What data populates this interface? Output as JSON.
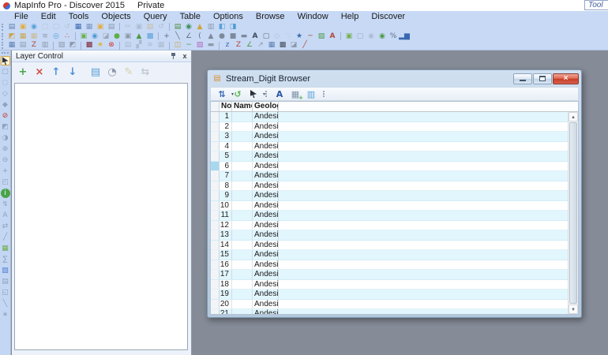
{
  "titlebar": {
    "title": "MapInfo Pro - Discover 2015",
    "private_label": "Private",
    "app_icon": "mapinfo-logo"
  },
  "tool_button": {
    "label": "Tool"
  },
  "menu": [
    "File",
    "Edit",
    "Tools",
    "Objects",
    "Query",
    "Table",
    "Options",
    "Browse",
    "Window",
    "Help",
    "Discover"
  ],
  "main_toolbar_rows": [
    [
      [
        {
          "n": "new-table",
          "g": "▤",
          "c": "#5f7fae"
        },
        {
          "n": "open",
          "g": "▣",
          "c": "#e2ae46"
        },
        {
          "n": "open-web-service",
          "g": "◉",
          "c": "#58a0d8"
        },
        {
          "n": "close-table",
          "g": "▢",
          "c": "#a6b2c2",
          "o": 0.55
        },
        {
          "n": "close-all",
          "g": "▢",
          "c": "#a6b2c2",
          "o": 0.55
        },
        {
          "n": "revert-table",
          "g": "↺",
          "c": "#a6b2c2",
          "o": 0.55
        },
        {
          "n": "save-table",
          "g": "▦",
          "c": "#3a68b0"
        },
        {
          "n": "save-copy-as",
          "g": "▦",
          "c": "#7a97c4"
        },
        {
          "n": "save-workspace",
          "g": "▣",
          "c": "#e2ae46"
        },
        {
          "n": "print",
          "g": "▤",
          "c": "#8d99aa"
        }
      ],
      [
        {
          "n": "cut",
          "g": "✂",
          "c": "#9aa6b6",
          "o": 0.55
        },
        {
          "n": "copy",
          "g": "▣",
          "c": "#9aa6b6",
          "o": 0.55
        },
        {
          "n": "paste",
          "g": "▤",
          "c": "#c9a45a",
          "o": 0.55
        },
        {
          "n": "undo",
          "g": "↺",
          "c": "#9aa6b6",
          "o": 0.55
        }
      ],
      [
        {
          "n": "new-browser",
          "g": "▤",
          "c": "#4d8e3f"
        },
        {
          "n": "new-mapper",
          "g": "◉",
          "c": "#3f8e5a"
        },
        {
          "n": "new-grapher",
          "g": "▲",
          "c": "#d2a23c"
        },
        {
          "n": "new-layout",
          "g": "▥",
          "c": "#8d99aa"
        },
        {
          "n": "new-redistricter",
          "g": "◧",
          "c": "#58a0d8"
        },
        {
          "n": "window-hot-views",
          "g": "◨",
          "c": "#4e9ad4"
        }
      ]
    ],
    [
      [
        {
          "n": "invert-selection",
          "g": "◩",
          "c": "#caa64e"
        },
        {
          "n": "select-all",
          "g": "▦",
          "c": "#caa64e"
        },
        {
          "n": "unselect-all",
          "g": "▦",
          "c": "#caa64e",
          "o": 0.6
        },
        {
          "n": "table-structure",
          "g": "≡",
          "c": "#8d99aa"
        },
        {
          "n": "geocode",
          "g": "◎",
          "c": "#58a0d8"
        },
        {
          "n": "create-points",
          "g": "∴",
          "c": "#c0564a"
        }
      ],
      [
        {
          "n": "run-mapbasic",
          "g": "▣",
          "c": "#6fae4e"
        },
        {
          "n": "world-map",
          "g": "◉",
          "c": "#4e9ad4"
        },
        {
          "n": "graph-window",
          "g": "◪",
          "c": "#9aa6b6"
        },
        {
          "n": "debug-tool",
          "g": "●",
          "c": "#5fae46"
        },
        {
          "n": "snapshot",
          "g": "▣",
          "c": "#8d99aa"
        },
        {
          "n": "tree-layers",
          "g": "▲",
          "c": "#4e9a46"
        },
        {
          "n": "packager",
          "g": "▩",
          "c": "#58a0d8"
        }
      ],
      [
        {
          "n": "symbol-tool",
          "g": "+",
          "c": "#5f6e80"
        },
        {
          "n": "line-tool",
          "g": "╲",
          "c": "#5f6e80"
        },
        {
          "n": "polyline-tool",
          "g": "∠",
          "c": "#5f6e80"
        },
        {
          "n": "arc-tool",
          "g": "(",
          "c": "#5f6e80"
        },
        {
          "n": "polygon-tool",
          "g": "▲",
          "c": "#7d8a9a"
        },
        {
          "n": "ellipse-tool",
          "g": "●",
          "c": "#7d8a9a"
        },
        {
          "n": "rectangle-tool",
          "g": "■",
          "c": "#7d8a9a"
        },
        {
          "n": "rounded-rectangle-tool",
          "g": "▬",
          "c": "#7d8a9a"
        },
        {
          "n": "text-tool",
          "g": "A",
          "c": "#3d4a5a"
        },
        {
          "n": "frame-tool",
          "g": "▢",
          "c": "#5f6e80"
        },
        {
          "n": "reshape-tool",
          "g": "◇",
          "c": "#9aa6b6",
          "o": 0.55
        },
        {
          "n": "add-node-tool",
          "g": "∵",
          "c": "#9aa6b6",
          "o": 0.55
        },
        {
          "n": "symbol-style",
          "g": "★",
          "c": "#3a68b0"
        },
        {
          "n": "line-style",
          "g": "─",
          "c": "#b04a3c"
        },
        {
          "n": "region-style",
          "g": "▨",
          "c": "#4e9a46"
        },
        {
          "n": "text-style",
          "g": "A",
          "c": "#b04a3c"
        }
      ],
      [
        {
          "n": "discover-folder",
          "g": "▣",
          "c": "#76b050"
        },
        {
          "n": "discover-window",
          "g": "▢",
          "c": "#9aa6b6"
        },
        {
          "n": "discover-link",
          "g": "◉",
          "c": "#9aa6b6",
          "o": 0.6
        },
        {
          "n": "discover-world",
          "g": "◉",
          "c": "#4e9a46"
        },
        {
          "n": "discover-scale",
          "g": "%",
          "c": "#5f6e80"
        },
        {
          "n": "discover-graph",
          "g": "▂▆",
          "c": "#3a68b0"
        }
      ]
    ],
    [
      [
        {
          "n": "browse-results",
          "g": "▦",
          "c": "#5a7fae"
        },
        {
          "n": "table-list",
          "g": "▤",
          "c": "#8d99aa"
        },
        {
          "n": "update-column",
          "g": "Z",
          "c": "#b04a3c"
        },
        {
          "n": "table-query",
          "g": "▥",
          "c": "#8d99aa"
        }
      ],
      [
        {
          "n": "select-rectangle",
          "g": "▧",
          "c": "#8d99aa"
        },
        {
          "n": "select-region",
          "g": "◩",
          "c": "#8d99aa"
        }
      ],
      [
        {
          "n": "mapbasic-window",
          "g": "▩",
          "c": "#7c2230"
        },
        {
          "n": "favorites",
          "g": "★",
          "c": "#e0b53c"
        },
        {
          "n": "stop-tool",
          "g": "⊗",
          "c": "#cf3b2f"
        }
      ],
      [
        {
          "n": "grid-create",
          "g": "▤",
          "c": "#9aa6b6",
          "o": 0.6
        },
        {
          "n": "grid-slope",
          "g": "▞",
          "c": "#9aa6b6",
          "o": 0.6
        },
        {
          "n": "grid-contour",
          "g": "≋",
          "c": "#9aa6b6",
          "o": 0.6
        },
        {
          "n": "grid-query",
          "g": "▦",
          "c": "#9aa6b6",
          "o": 0.6
        }
      ],
      [
        {
          "n": "legend-editor",
          "g": "◫",
          "c": "#caa64e"
        },
        {
          "n": "profile-tool",
          "g": "~",
          "c": "#4e9a46"
        },
        {
          "n": "colour-patterns",
          "g": "▧",
          "c": "#b06ac0"
        },
        {
          "n": "layout-tool",
          "g": "▬",
          "c": "#8d99aa"
        }
      ],
      [
        {
          "n": "digitise-z",
          "g": "z",
          "c": "#3a68b0"
        },
        {
          "n": "digitise-z-up",
          "g": "Z",
          "c": "#b04a3c"
        },
        {
          "n": "digitise-angle",
          "g": "∠",
          "c": "#4e9a46"
        },
        {
          "n": "digitise-bearing",
          "g": "↗",
          "c": "#8d99aa"
        },
        {
          "n": "digitise-grid",
          "g": "▦",
          "c": "#5a7fae"
        },
        {
          "n": "digitise-solid",
          "g": "▩",
          "c": "#444e5a"
        },
        {
          "n": "digitise-half",
          "g": "◪",
          "c": "#8d99aa"
        },
        {
          "n": "digitise-line",
          "g": "╱",
          "c": "#b04a3c"
        }
      ]
    ]
  ],
  "left_toolbar": {
    "items": [
      {
        "n": "select-tool",
        "cur": true,
        "active": true
      },
      {
        "n": "marquee-select",
        "g": "▢",
        "c": "#5f6e80",
        "o": 0.5
      },
      {
        "n": "radius-select",
        "g": "◌",
        "c": "#5f6e80",
        "o": 0.5
      },
      {
        "n": "polygon-select",
        "g": "◇",
        "c": "#5f6e80",
        "o": 0.5
      },
      {
        "n": "boundary-select",
        "g": "◆",
        "c": "#5f6e80",
        "o": 0.5
      },
      {
        "n": "unselect-all",
        "g": "⊘",
        "c": "#c23b30"
      },
      {
        "n": "invert-selection",
        "g": "◩",
        "c": "#5f6e80",
        "o": 0.5
      },
      {
        "n": "graph-select",
        "g": "◑",
        "c": "#5f6e80",
        "o": 0.5
      },
      {
        "n": "zoom-in",
        "g": "⊕",
        "c": "#5f6e80",
        "o": 0.5
      },
      {
        "n": "zoom-out",
        "g": "⊖",
        "c": "#5f6e80",
        "o": 0.5
      },
      {
        "n": "pan-hand",
        "g": "+",
        "c": "#5f6e80",
        "o": 0.5
      },
      {
        "n": "change-view",
        "g": "◰",
        "c": "#5f6e80",
        "o": 0.5
      },
      {
        "n": "info-tool",
        "g": "i",
        "c": "#ffffff",
        "bgc": "#4aa34a"
      },
      {
        "n": "hotlink-tool",
        "g": "↯",
        "c": "#5f6e80",
        "o": 0.5
      },
      {
        "n": "label-tool",
        "g": "A",
        "c": "#5f6e80",
        "o": 0.5
      },
      {
        "n": "drag-map-window",
        "g": "⇄",
        "c": "#5f6e80",
        "o": 0.5
      },
      {
        "n": "ruler-tool",
        "g": "╱",
        "c": "#5f6e80",
        "o": 0.5
      },
      {
        "n": "show-legend",
        "g": "▦",
        "c": "#6fae4e"
      },
      {
        "n": "statistics-tool",
        "g": "∑",
        "c": "#5f6e80",
        "o": 0.5
      },
      {
        "n": "image-registration",
        "g": "▨",
        "c": "#4e7fd0"
      },
      {
        "n": "set-target-district",
        "g": "▤",
        "c": "#5f6e80",
        "o": 0.5
      },
      {
        "n": "clip-region",
        "g": "◱",
        "c": "#5f6e80",
        "o": 0.5
      },
      {
        "n": "eyedropper-tool",
        "g": "╲",
        "c": "#5f6e80",
        "o": 0.5
      },
      {
        "n": "tool-options",
        "g": "∗",
        "c": "#5f6e80",
        "o": 0.5
      }
    ]
  },
  "layer_control": {
    "title": "Layer Control",
    "header_icons": [
      "auto-hide-pin-icon",
      "close-icon"
    ],
    "buttons": [
      {
        "n": "add-layers",
        "g": "+",
        "c": "#4aa34a"
      },
      {
        "n": "remove-layers",
        "g": "×",
        "c": "#d24b3f"
      },
      {
        "n": "move-layer-up",
        "g": "↑",
        "c": "#4a8fd4"
      },
      {
        "n": "move-layer-down",
        "g": "↓",
        "c": "#4a8fd4"
      },
      {
        "n": "gap"
      },
      {
        "n": "layer-visibility",
        "g": "▤",
        "c": "#58a0d8"
      },
      {
        "n": "layer-zoom-override",
        "g": "◔",
        "c": "#8d99aa"
      },
      {
        "n": "layer-editable",
        "g": "✎",
        "c": "#b0a14e",
        "dis": true
      },
      {
        "n": "layer-movable",
        "g": "⇆",
        "c": "#8d99aa",
        "dis": true
      }
    ]
  },
  "browser": {
    "title": "Stream_Digit Browser",
    "window_buttons": [
      "minimize",
      "restore",
      "close"
    ],
    "toolbar": [
      {
        "n": "sort-filter",
        "g": "⇅",
        "c": "#3a68b0",
        "caret": true
      },
      {
        "n": "refresh",
        "g": "↺",
        "c": "#58b84e"
      },
      {
        "n": "select-arrow",
        "cur": true,
        "caret": true
      },
      {
        "n": "grip-dots"
      },
      {
        "n": "font-style",
        "g": "A",
        "c": "#2a56a8"
      },
      {
        "n": "append-rows",
        "g": "▦",
        "c": "#7e93ab",
        "ov": "+",
        "oc": "#3fae3f"
      },
      {
        "n": "pick-fields",
        "g": "▥",
        "c": "#58a0d8"
      },
      {
        "n": "grip-dots"
      }
    ],
    "columns": [
      "No",
      "Name",
      "Geology"
    ],
    "selected_row": 6,
    "rows": [
      {
        "no": "1",
        "name": "",
        "geology": "Andesite"
      },
      {
        "no": "2",
        "name": "",
        "geology": "Andesite"
      },
      {
        "no": "3",
        "name": "",
        "geology": "Andesite"
      },
      {
        "no": "4",
        "name": "",
        "geology": "Andesite"
      },
      {
        "no": "5",
        "name": "",
        "geology": "Andesite"
      },
      {
        "no": "6",
        "name": "",
        "geology": "Andesite"
      },
      {
        "no": "7",
        "name": "",
        "geology": "Andesite"
      },
      {
        "no": "8",
        "name": "",
        "geology": "Andesite"
      },
      {
        "no": "9",
        "name": "",
        "geology": "Andesite"
      },
      {
        "no": "10",
        "name": "",
        "geology": "Andesite"
      },
      {
        "no": "11",
        "name": "",
        "geology": "Andesite"
      },
      {
        "no": "12",
        "name": "",
        "geology": "Andesite"
      },
      {
        "no": "13",
        "name": "",
        "geology": "Andesite"
      },
      {
        "no": "14",
        "name": "",
        "geology": "Andesite"
      },
      {
        "no": "15",
        "name": "",
        "geology": "Andesite"
      },
      {
        "no": "16",
        "name": "",
        "geology": "Andesite"
      },
      {
        "no": "17",
        "name": "",
        "geology": "Andesite"
      },
      {
        "no": "18",
        "name": "",
        "geology": "Andesite"
      },
      {
        "no": "19",
        "name": "",
        "geology": "Andesite"
      },
      {
        "no": "20",
        "name": "",
        "geology": "Andesite"
      },
      {
        "no": "21",
        "name": "",
        "geology": "Andesite"
      }
    ]
  },
  "colors": {
    "menubar_bg": "#c7d9f5",
    "mdi_bg": "#858b97",
    "row_stripe": "#e2f6fd",
    "row_white": "#ffffff",
    "selected_row_marker": "#a8d8f0",
    "close_button": "#c63e28",
    "window_frame": "#b2c8dd"
  }
}
